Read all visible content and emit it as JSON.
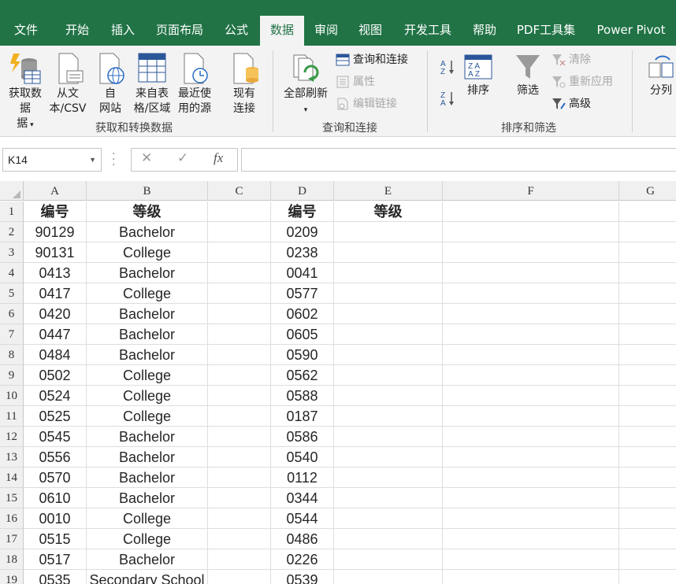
{
  "ribbon_tabs": [
    "文件",
    "开始",
    "插入",
    "页面布局",
    "公式",
    "数据",
    "审阅",
    "视图",
    "开发工具",
    "帮助",
    "PDF工具集",
    "Power Pivot"
  ],
  "active_tab": "数据",
  "groups": {
    "get_transform": {
      "label": "获取和转换数据",
      "get_data": "获取数据",
      "get_data_2": "据",
      "from_text_1": "从文",
      "from_text_2": "本/CSV",
      "from_web_1": "自",
      "from_web_2": "网站",
      "from_table_1": "来自表",
      "from_table_2": "格/区域",
      "recent_1": "最近使",
      "recent_2": "用的源",
      "existing_1": "现有",
      "existing_2": "连接"
    },
    "queries": {
      "label": "查询和连接",
      "refresh_all": "全部刷新",
      "queries_connections": "查询和连接",
      "properties": "属性",
      "edit_links": "编辑链接"
    },
    "sort_filter": {
      "label": "排序和筛选",
      "sort": "排序",
      "filter": "筛选",
      "clear": "清除",
      "reapply": "重新应用",
      "advanced": "高级"
    },
    "data_tools": {
      "split": "分列"
    }
  },
  "formula_bar": {
    "name_box": "K14",
    "fx": "fx",
    "formula": ""
  },
  "columns": [
    "A",
    "B",
    "C",
    "D",
    "E",
    "F",
    "G"
  ],
  "rows": [
    {
      "n": "1",
      "A": "编号",
      "B": "等级",
      "C": "",
      "D": "编号",
      "E": "等级"
    },
    {
      "n": "2",
      "A": "90129",
      "B": "Bachelor",
      "C": "",
      "D": "0209",
      "E": ""
    },
    {
      "n": "3",
      "A": "90131",
      "B": "College",
      "C": "",
      "D": "0238",
      "E": ""
    },
    {
      "n": "4",
      "A": "0413",
      "B": "Bachelor",
      "C": "",
      "D": "0041",
      "E": ""
    },
    {
      "n": "5",
      "A": "0417",
      "B": "College",
      "C": "",
      "D": "0577",
      "E": ""
    },
    {
      "n": "6",
      "A": "0420",
      "B": "Bachelor",
      "C": "",
      "D": "0602",
      "E": ""
    },
    {
      "n": "7",
      "A": "0447",
      "B": "Bachelor",
      "C": "",
      "D": "0605",
      "E": ""
    },
    {
      "n": "8",
      "A": "0484",
      "B": "Bachelor",
      "C": "",
      "D": "0590",
      "E": ""
    },
    {
      "n": "9",
      "A": "0502",
      "B": "College",
      "C": "",
      "D": "0562",
      "E": ""
    },
    {
      "n": "10",
      "A": "0524",
      "B": "College",
      "C": "",
      "D": "0588",
      "E": ""
    },
    {
      "n": "11",
      "A": "0525",
      "B": "College",
      "C": "",
      "D": "0187",
      "E": ""
    },
    {
      "n": "12",
      "A": "0545",
      "B": "Bachelor",
      "C": "",
      "D": "0586",
      "E": ""
    },
    {
      "n": "13",
      "A": "0556",
      "B": "Bachelor",
      "C": "",
      "D": "0540",
      "E": ""
    },
    {
      "n": "14",
      "A": "0570",
      "B": "Bachelor",
      "C": "",
      "D": "0112",
      "E": ""
    },
    {
      "n": "15",
      "A": "0610",
      "B": "Bachelor",
      "C": "",
      "D": "0344",
      "E": ""
    },
    {
      "n": "16",
      "A": "0010",
      "B": "College",
      "C": "",
      "D": "0544",
      "E": ""
    },
    {
      "n": "17",
      "A": "0515",
      "B": "College",
      "C": "",
      "D": "0486",
      "E": ""
    },
    {
      "n": "18",
      "A": "0517",
      "B": "Bachelor",
      "C": "",
      "D": "0226",
      "E": ""
    },
    {
      "n": "19",
      "A": "0535",
      "B": "Secondary School",
      "C": "",
      "D": "0539",
      "E": ""
    }
  ],
  "colors": {
    "tab_bar": "#217346",
    "ribbon_bg": "#f3f3f3",
    "header_bg": "#f0f0f0"
  }
}
